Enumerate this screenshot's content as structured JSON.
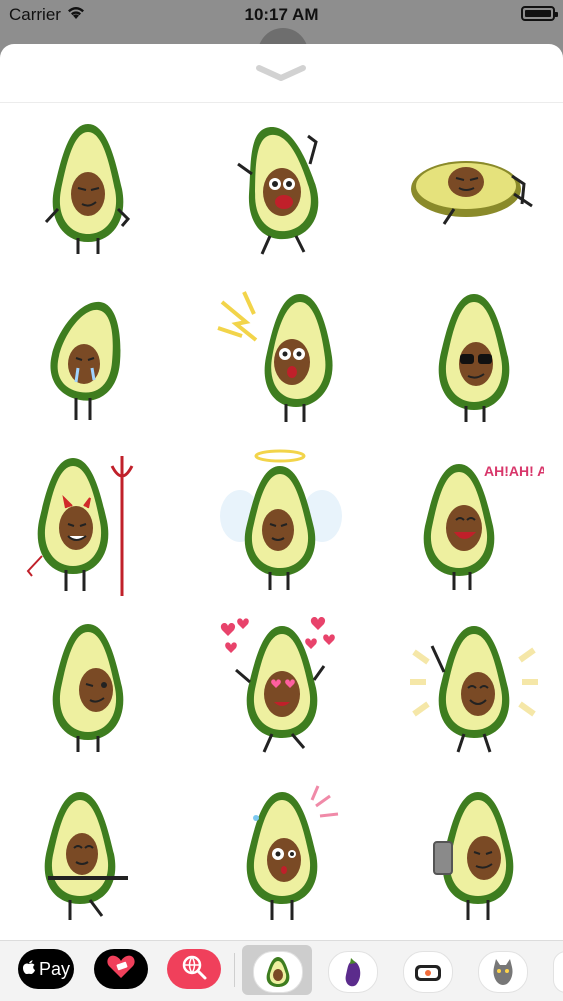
{
  "status_bar": {
    "carrier": "Carrier",
    "time": "10:17 AM"
  },
  "stickers": [
    {
      "name": "smug-avocado"
    },
    {
      "name": "laughing-avocado"
    },
    {
      "name": "lying-avocado"
    },
    {
      "name": "crying-avocado"
    },
    {
      "name": "shocked-avocado"
    },
    {
      "name": "sunglasses-avocado"
    },
    {
      "name": "devil-avocado"
    },
    {
      "name": "angel-avocado"
    },
    {
      "name": "ahah-avocado",
      "caption": "AH!AH! AH!"
    },
    {
      "name": "winking-avocado"
    },
    {
      "name": "love-avocado"
    },
    {
      "name": "happy-avocado"
    },
    {
      "name": "pointing-avocado"
    },
    {
      "name": "surprised-avocado"
    },
    {
      "name": "selfie-avocado"
    }
  ],
  "app_tray": {
    "apple_pay_label": "Pay",
    "apps": [
      "apple-pay",
      "heart-app",
      "search-app",
      "avocado-pack",
      "eggplant-pack",
      "sushi-pack",
      "cat-pack"
    ]
  },
  "colors": {
    "avocado_skin": "#3e7d1f",
    "avocado_flesh": "#eef0a0",
    "avocado_pit": "#7a4a25",
    "accent_pink": "#f0405b"
  }
}
